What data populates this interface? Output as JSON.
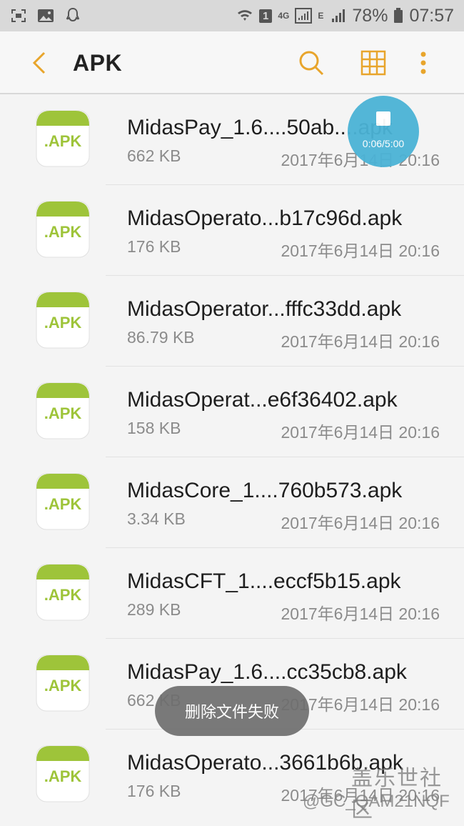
{
  "status_bar": {
    "left_icons": [
      "screenshot-icon",
      "gallery-icon",
      "qq-icon"
    ],
    "sim_badge": "1",
    "network_label": "4G",
    "network_label_2": "E",
    "battery_percent": "78%",
    "time": "07:57"
  },
  "app_bar": {
    "title": "APK",
    "icons": [
      "back-icon",
      "search-icon",
      "grid-view-icon",
      "more-icon"
    ],
    "accent": "#e8a52c"
  },
  "files": [
    {
      "name": "MidasPay_1.6....50ab....apk",
      "size": "662 KB",
      "date": "2017年6月14日 20:16"
    },
    {
      "name": "MidasOperato...b17c96d.apk",
      "size": "176 KB",
      "date": "2017年6月14日 20:16"
    },
    {
      "name": "MidasOperator...fffc33dd.apk",
      "size": "86.79 KB",
      "date": "2017年6月14日 20:16"
    },
    {
      "name": "MidasOperat...e6f36402.apk",
      "size": "158 KB",
      "date": "2017年6月14日 20:16"
    },
    {
      "name": "MidasCore_1....760b573.apk",
      "size": "3.34 KB",
      "date": "2017年6月14日 20:16"
    },
    {
      "name": "MidasCFT_1....eccf5b15.apk",
      "size": "289 KB",
      "date": "2017年6月14日 20:16"
    },
    {
      "name": "MidasPay_1.6....cc35cb8.apk",
      "size": "662 KB",
      "date": "2017年6月14日 20:16"
    },
    {
      "name": "MidasOperato...3661b6b.apk",
      "size": "176 KB",
      "date": "2017年6月14日 20:16"
    }
  ],
  "apk_icon_label": ".APK",
  "recording": {
    "time": "0:06/5:00"
  },
  "toast": {
    "message": "删除文件失败"
  },
  "watermark": {
    "title": "盖乐世社区",
    "handle": "@GC_QAM21NQF"
  },
  "colors": {
    "apk_green": "#9ec43a",
    "record_blue": "#4bb3d6",
    "accent": "#e8a52c"
  }
}
